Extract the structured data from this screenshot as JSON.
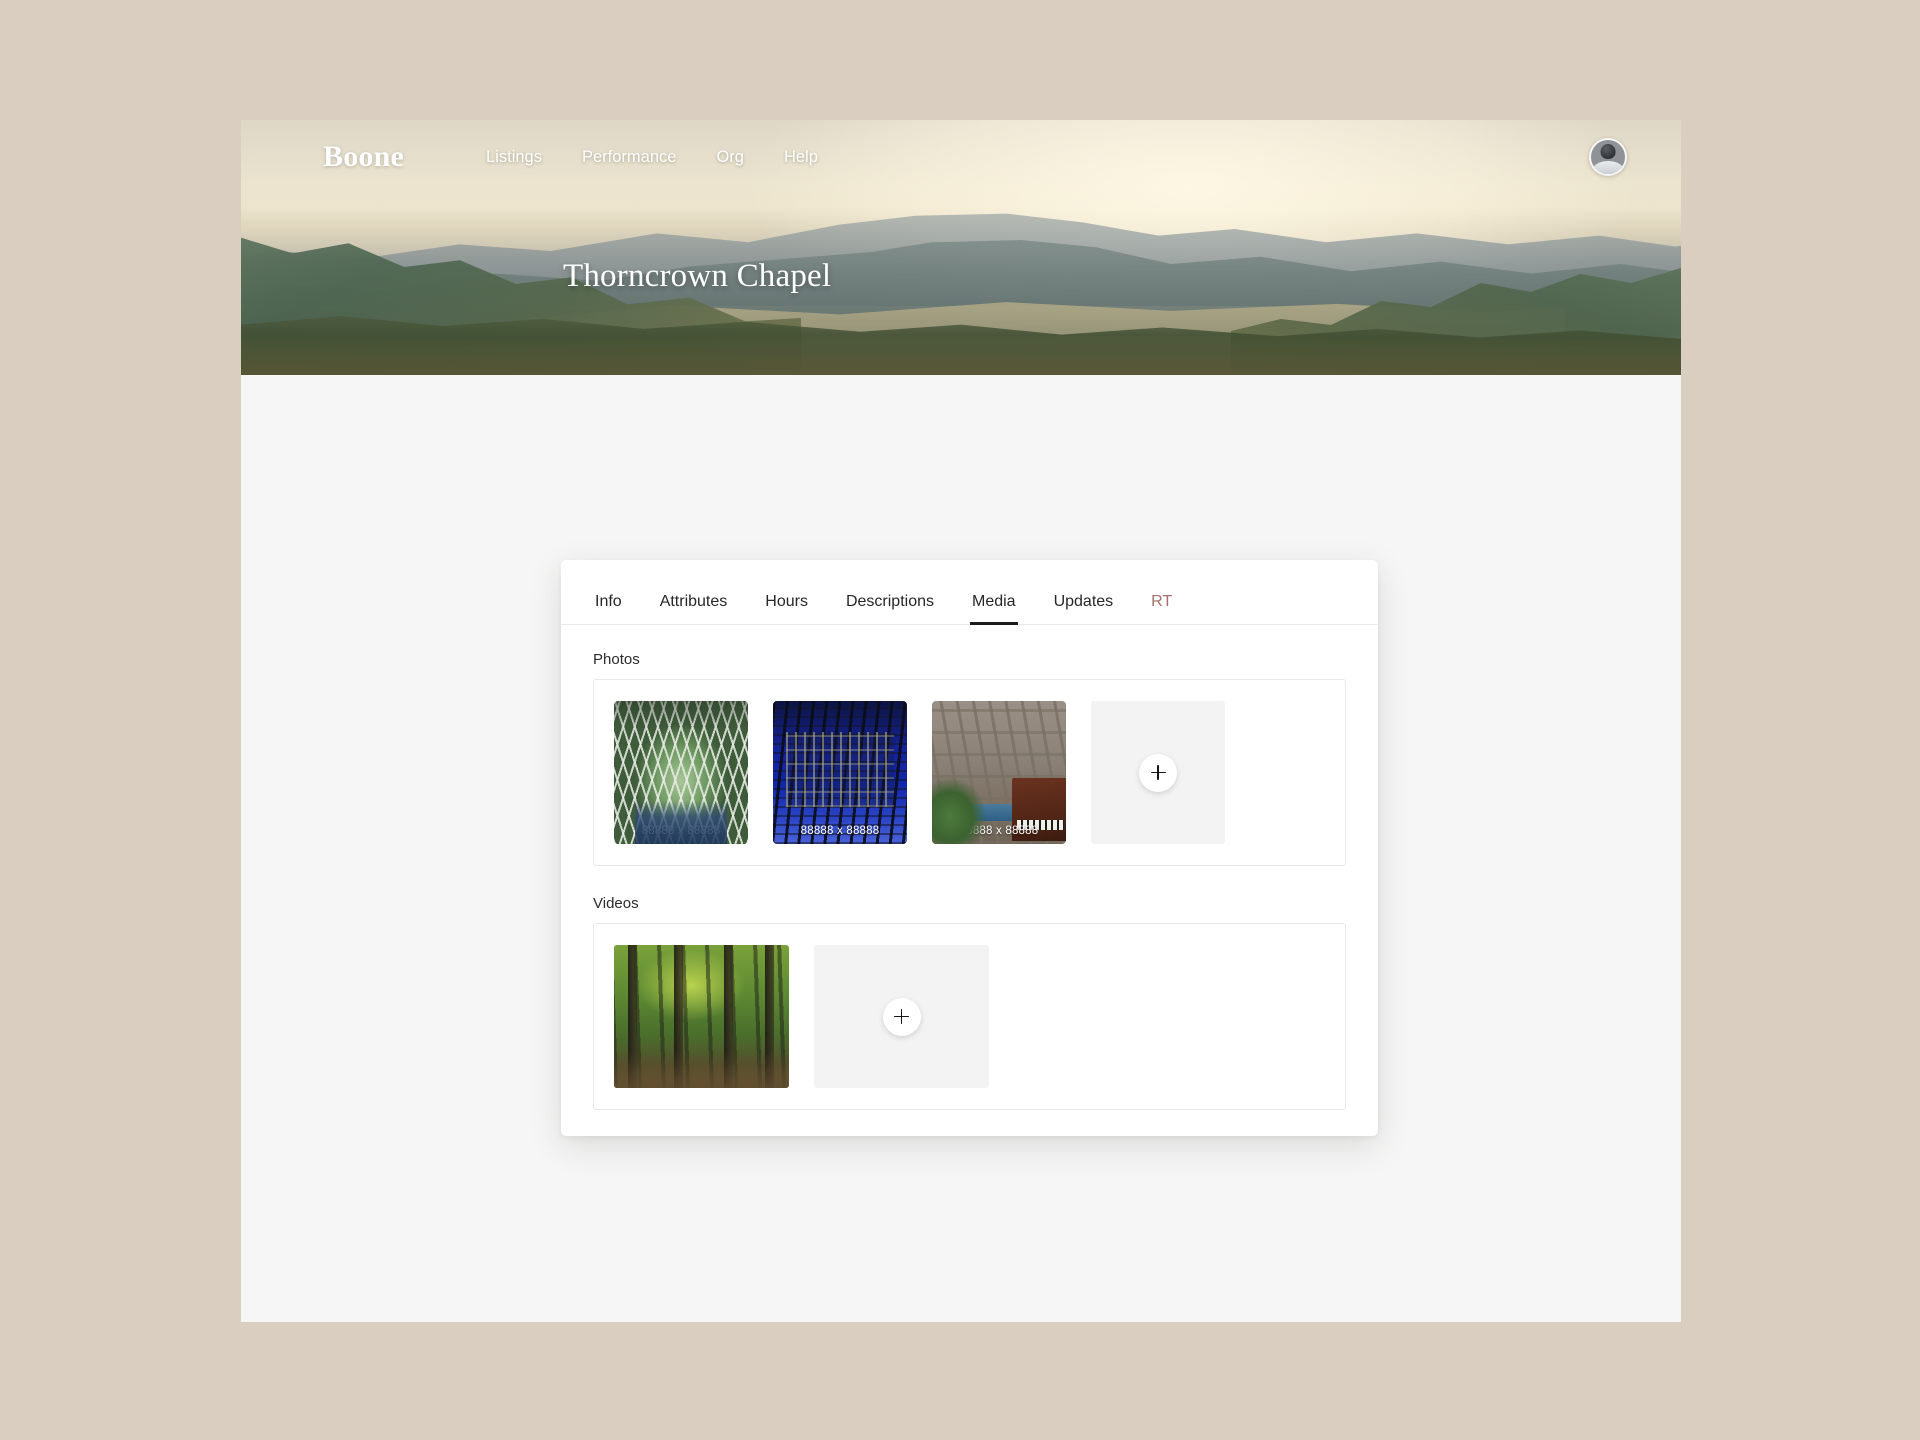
{
  "theme": {
    "page_background": "#d9cec0",
    "app_background": "#f6f6f6",
    "card_background": "#ffffff",
    "accent_rt": "#a5706a",
    "active_tab_underline": "#1b1b1b",
    "add_tile_background": "#f3f3f3"
  },
  "topnav": {
    "brand": "Boone",
    "links": [
      {
        "label": "Listings"
      },
      {
        "label": "Performance"
      },
      {
        "label": "Org"
      },
      {
        "label": "Help"
      }
    ],
    "avatar_icon": "user-avatar-icon"
  },
  "hero": {
    "page_title": "Thorncrown Chapel",
    "image_alt": "mountain-valley-landscape"
  },
  "tabs": [
    {
      "label": "Info",
      "active": false,
      "accent": false
    },
    {
      "label": "Attributes",
      "active": false,
      "accent": false
    },
    {
      "label": "Hours",
      "active": false,
      "accent": false
    },
    {
      "label": "Descriptions",
      "active": false,
      "accent": false
    },
    {
      "label": "Media",
      "active": true,
      "accent": false
    },
    {
      "label": "Updates",
      "active": false,
      "accent": false
    },
    {
      "label": "RT",
      "active": false,
      "accent": true
    }
  ],
  "media": {
    "photos": {
      "label": "Photos",
      "items": [
        {
          "dimensions": "88888 x 88888",
          "alt": "chapel-interior-nave"
        },
        {
          "dimensions": "88888 x 88888",
          "alt": "chapel-exterior-night-blue"
        },
        {
          "dimensions": "88888 x 88888",
          "alt": "chapel-interior-ferns-piano"
        }
      ],
      "add_button_icon": "plus-icon"
    },
    "videos": {
      "label": "Videos",
      "items": [
        {
          "alt": "chapel-forest-path-video"
        }
      ],
      "add_button_icon": "plus-icon"
    }
  }
}
